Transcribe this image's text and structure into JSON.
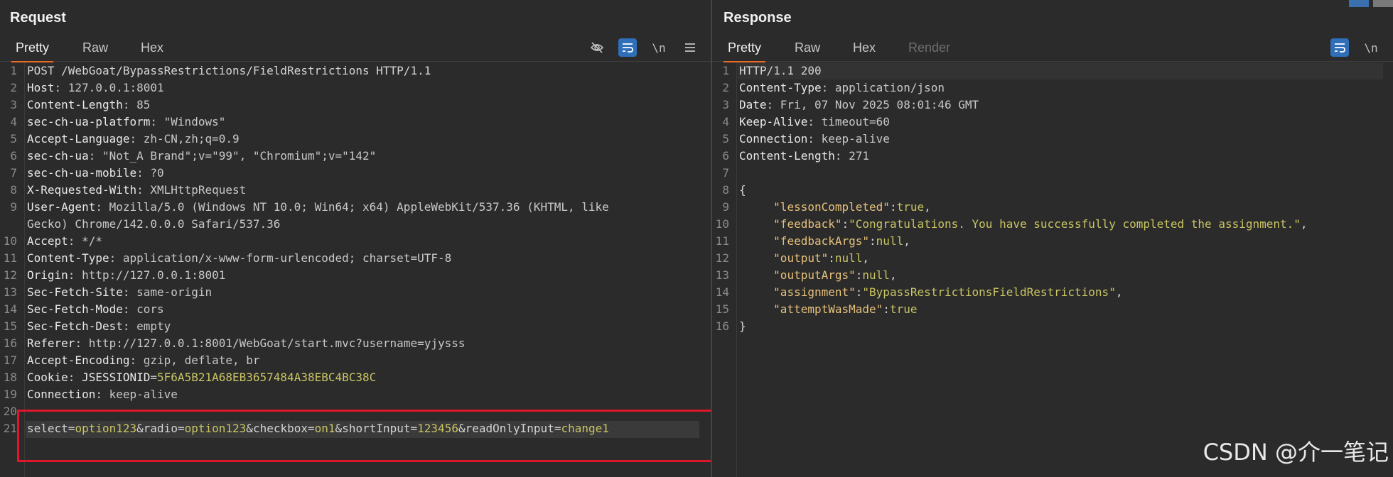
{
  "request": {
    "title": "Request",
    "tabs": [
      "Pretty",
      "Raw",
      "Hex"
    ],
    "icons": [
      "eye-off-icon",
      "wrap-icon",
      "newline-toggle-icon",
      "menu-icon"
    ],
    "newline_label": "\\n",
    "lines": [
      {
        "n": "1",
        "parts": [
          [
            "code",
            "POST /WebGoat/BypassRestrictions/FieldRestrictions HTTP/1.1"
          ]
        ]
      },
      {
        "n": "2",
        "parts": [
          [
            "hk",
            "Host"
          ],
          [
            "hv",
            ": 127.0.0.1:8001"
          ]
        ]
      },
      {
        "n": "3",
        "parts": [
          [
            "hk",
            "Content-Length"
          ],
          [
            "hv",
            ": 85"
          ]
        ]
      },
      {
        "n": "4",
        "parts": [
          [
            "hk",
            "sec-ch-ua-platform"
          ],
          [
            "hv",
            ": \"Windows\""
          ]
        ]
      },
      {
        "n": "5",
        "parts": [
          [
            "hk",
            "Accept-Language"
          ],
          [
            "hv",
            ": zh-CN,zh;q=0.9"
          ]
        ]
      },
      {
        "n": "6",
        "parts": [
          [
            "hk",
            "sec-ch-ua"
          ],
          [
            "hv",
            ": \"Not_A Brand\";v=\"99\", \"Chromium\";v=\"142\""
          ]
        ]
      },
      {
        "n": "7",
        "parts": [
          [
            "hk",
            "sec-ch-ua-mobile"
          ],
          [
            "hv",
            ": ?0"
          ]
        ]
      },
      {
        "n": "8",
        "parts": [
          [
            "hk",
            "X-Requested-With"
          ],
          [
            "hv",
            ": XMLHttpRequest"
          ]
        ]
      },
      {
        "n": "9",
        "parts": [
          [
            "hk",
            "User-Agent"
          ],
          [
            "hv",
            ": Mozilla/5.0 (Windows NT 10.0; Win64; x64) AppleWebKit/537.36 (KHTML, like"
          ]
        ]
      },
      {
        "n": "",
        "parts": [
          [
            "hv",
            "Gecko) Chrome/142.0.0.0 Safari/537.36"
          ]
        ]
      },
      {
        "n": "10",
        "parts": [
          [
            "hk",
            "Accept"
          ],
          [
            "hv",
            ": */*"
          ]
        ]
      },
      {
        "n": "11",
        "parts": [
          [
            "hk",
            "Content-Type"
          ],
          [
            "hv",
            ": application/x-www-form-urlencoded; charset=UTF-8"
          ]
        ]
      },
      {
        "n": "12",
        "parts": [
          [
            "hk",
            "Origin"
          ],
          [
            "hv",
            ": http://127.0.0.1:8001"
          ]
        ]
      },
      {
        "n": "13",
        "parts": [
          [
            "hk",
            "Sec-Fetch-Site"
          ],
          [
            "hv",
            ": same-origin"
          ]
        ]
      },
      {
        "n": "14",
        "parts": [
          [
            "hk",
            "Sec-Fetch-Mode"
          ],
          [
            "hv",
            ": cors"
          ]
        ]
      },
      {
        "n": "15",
        "parts": [
          [
            "hk",
            "Sec-Fetch-Dest"
          ],
          [
            "hv",
            ": empty"
          ]
        ]
      },
      {
        "n": "16",
        "parts": [
          [
            "hk",
            "Referer"
          ],
          [
            "hv",
            ": http://127.0.0.1:8001/WebGoat/start.mvc?username=yjysss"
          ]
        ]
      },
      {
        "n": "17",
        "parts": [
          [
            "hk",
            "Accept-Encoding"
          ],
          [
            "hv",
            ": gzip, deflate, br"
          ]
        ]
      },
      {
        "n": "18",
        "parts": [
          [
            "hk",
            "Cookie"
          ],
          [
            "hv",
            ": "
          ],
          [
            "hk",
            "JSESSIONID"
          ],
          [
            "hv",
            "="
          ],
          [
            "cookie-v",
            "5F6A5B21A68EB3657484A38EBC4BC38C"
          ]
        ]
      },
      {
        "n": "19",
        "parts": [
          [
            "hk",
            "Connection"
          ],
          [
            "hv",
            ": keep-alive"
          ]
        ]
      },
      {
        "n": "20",
        "parts": []
      },
      {
        "n": "21",
        "parts": [
          [
            "pk",
            "select"
          ],
          [
            "code",
            "="
          ],
          [
            "pv",
            "option123"
          ],
          [
            "code",
            "&"
          ],
          [
            "pk",
            "radio"
          ],
          [
            "code",
            "="
          ],
          [
            "pv",
            "option123"
          ],
          [
            "code",
            "&"
          ],
          [
            "pk",
            "checkbox"
          ],
          [
            "code",
            "="
          ],
          [
            "pv",
            "on1"
          ],
          [
            "code",
            "&"
          ],
          [
            "pk",
            "shortInput"
          ],
          [
            "code",
            "="
          ],
          [
            "pv",
            "123456"
          ],
          [
            "code",
            "&"
          ],
          [
            "pk",
            "readOnlyInput"
          ],
          [
            "code",
            "="
          ],
          [
            "pv",
            "change1"
          ]
        ]
      }
    ]
  },
  "response": {
    "title": "Response",
    "tabs": [
      "Pretty",
      "Raw",
      "Hex",
      "Render"
    ],
    "icons": [
      "wrap-icon",
      "newline-toggle-icon"
    ],
    "newline_label": "\\n",
    "lines": [
      {
        "n": "1",
        "parts": [
          [
            "code",
            "HTTP/1.1 200"
          ]
        ]
      },
      {
        "n": "2",
        "parts": [
          [
            "hk",
            "Content-Type"
          ],
          [
            "hv",
            ": application/json"
          ]
        ]
      },
      {
        "n": "3",
        "parts": [
          [
            "hk",
            "Date"
          ],
          [
            "hv",
            ": Fri, 07 Nov 2025 08:01:46 GMT"
          ]
        ]
      },
      {
        "n": "4",
        "parts": [
          [
            "hk",
            "Keep-Alive"
          ],
          [
            "hv",
            ": timeout=60"
          ]
        ]
      },
      {
        "n": "5",
        "parts": [
          [
            "hk",
            "Connection"
          ],
          [
            "hv",
            ": keep-alive"
          ]
        ]
      },
      {
        "n": "6",
        "parts": [
          [
            "hk",
            "Content-Length"
          ],
          [
            "hv",
            ": 271"
          ]
        ]
      },
      {
        "n": "7",
        "parts": []
      },
      {
        "n": "8",
        "parts": [
          [
            "jb",
            "{"
          ]
        ]
      },
      {
        "n": "9",
        "parts": [
          [
            "jb",
            "     "
          ],
          [
            "jk",
            "\"lessonCompleted\""
          ],
          [
            "jb",
            ":"
          ],
          [
            "jv",
            "true"
          ],
          [
            "jb",
            ","
          ]
        ]
      },
      {
        "n": "10",
        "parts": [
          [
            "jb",
            "     "
          ],
          [
            "jk",
            "\"feedback\""
          ],
          [
            "jb",
            ":"
          ],
          [
            "jv",
            "\"Congratulations. You have successfully completed the assignment.\""
          ],
          [
            "jb",
            ","
          ]
        ]
      },
      {
        "n": "11",
        "parts": [
          [
            "jb",
            "     "
          ],
          [
            "jk",
            "\"feedbackArgs\""
          ],
          [
            "jb",
            ":"
          ],
          [
            "jv",
            "null"
          ],
          [
            "jb",
            ","
          ]
        ]
      },
      {
        "n": "12",
        "parts": [
          [
            "jb",
            "     "
          ],
          [
            "jk",
            "\"output\""
          ],
          [
            "jb",
            ":"
          ],
          [
            "jv",
            "null"
          ],
          [
            "jb",
            ","
          ]
        ]
      },
      {
        "n": "13",
        "parts": [
          [
            "jb",
            "     "
          ],
          [
            "jk",
            "\"outputArgs\""
          ],
          [
            "jb",
            ":"
          ],
          [
            "jv",
            "null"
          ],
          [
            "jb",
            ","
          ]
        ]
      },
      {
        "n": "14",
        "parts": [
          [
            "jb",
            "     "
          ],
          [
            "jk",
            "\"assignment\""
          ],
          [
            "jb",
            ":"
          ],
          [
            "jv",
            "\"BypassRestrictionsFieldRestrictions\""
          ],
          [
            "jb",
            ","
          ]
        ]
      },
      {
        "n": "15",
        "parts": [
          [
            "jb",
            "     "
          ],
          [
            "jk",
            "\"attemptWasMade\""
          ],
          [
            "jb",
            ":"
          ],
          [
            "jv",
            "true"
          ]
        ]
      },
      {
        "n": "16",
        "parts": [
          [
            "jb",
            "}"
          ]
        ]
      }
    ]
  },
  "watermark": "CSDN @介一笔记",
  "colors": {
    "highlight_box": "#e0162a",
    "active_tab_underline": "#e86a28",
    "active_icon_bg": "#2f6fba"
  }
}
